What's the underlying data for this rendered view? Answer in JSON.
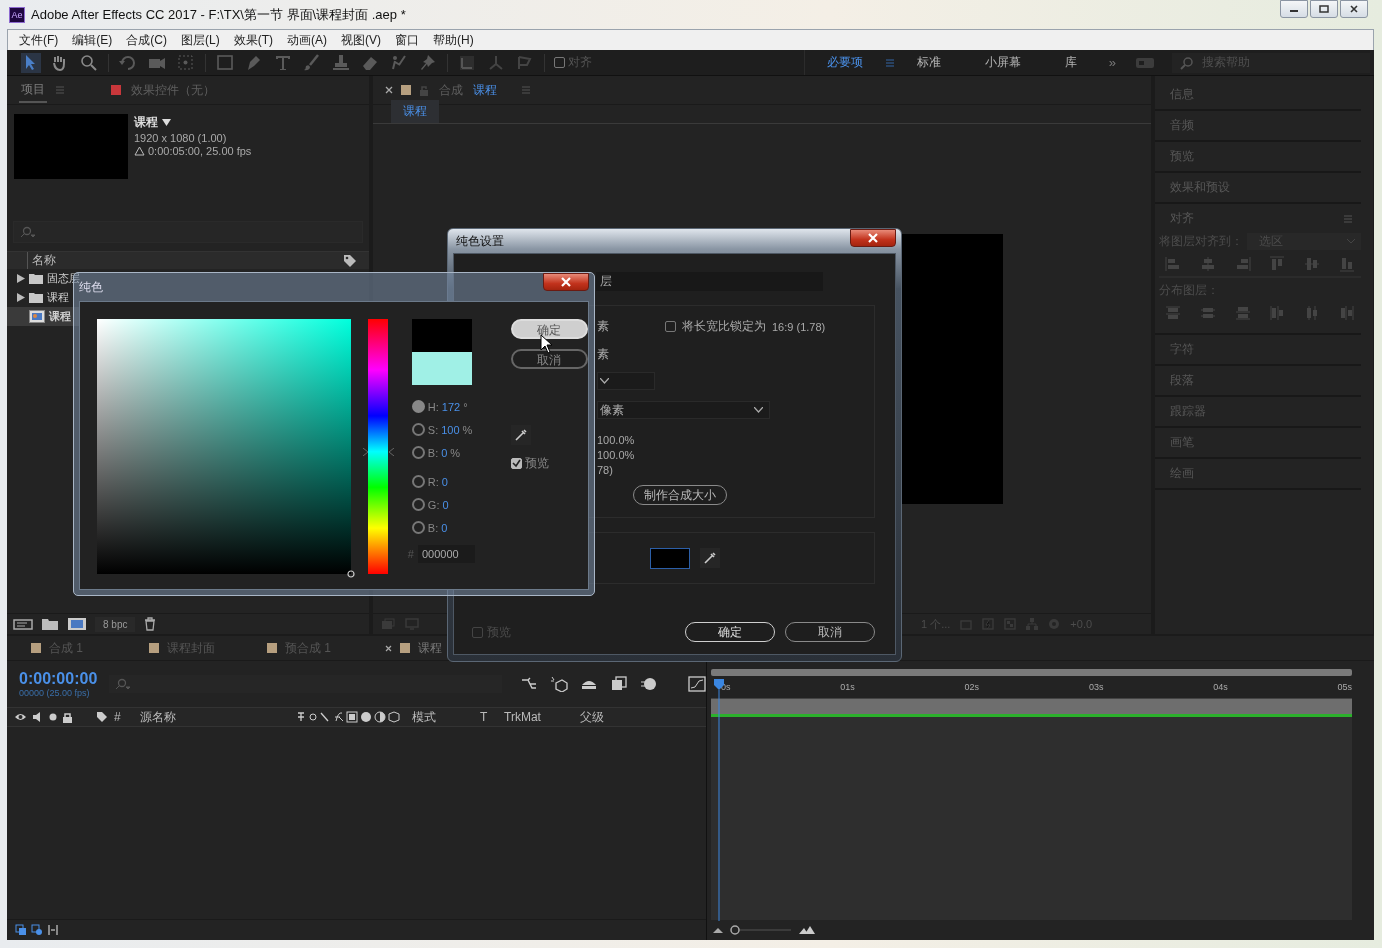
{
  "window": {
    "app_badge": "Ae",
    "title": "Adobe After Effects CC 2017 - F:\\TX\\第一节 界面\\课程封面 .aep *"
  },
  "menu": [
    {
      "label": "文件(F)"
    },
    {
      "label": "编辑(E)"
    },
    {
      "label": "合成(C)"
    },
    {
      "label": "图层(L)"
    },
    {
      "label": "效果(T)"
    },
    {
      "label": "动画(A)"
    },
    {
      "label": "视图(V)"
    },
    {
      "label": "窗口"
    },
    {
      "label": "帮助(H)"
    }
  ],
  "toolbar": {
    "snap": {
      "label": "对齐",
      "checked": false
    },
    "workspaces": [
      {
        "label": "必要项",
        "selected": true
      },
      {
        "label": "标准",
        "selected": false
      },
      {
        "label": "小屏幕",
        "selected": false
      },
      {
        "label": "库",
        "selected": false
      }
    ],
    "more": "»",
    "search": {
      "placeholder": "搜索帮助"
    }
  },
  "project_panel": {
    "tabs": [
      {
        "label": "项目",
        "selected": true
      },
      {
        "label": "效果控件（无）",
        "selected": false
      }
    ],
    "item": {
      "name": "课程",
      "size": "1920 x 1080 (1.00)",
      "duration": "0:00:05:00, 25.00 fps"
    },
    "name_column": "名称",
    "rows": [
      {
        "kind": "folder",
        "name": "固态层",
        "selected": false
      },
      {
        "kind": "folder",
        "name": "课程",
        "selected": false
      },
      {
        "kind": "composition",
        "name": "课程",
        "selected": true
      }
    ],
    "bit_depth": "8 bpc"
  },
  "comp_panel": {
    "tab": {
      "prefix": "合成",
      "name": "课程"
    },
    "view_tabs": [
      {
        "label": "课程",
        "selected": true
      }
    ],
    "footer": {
      "layers": "1 个...",
      "exposure": "+0.0"
    }
  },
  "right_panel": {
    "panels": [
      {
        "label": "信息",
        "expanded": false
      },
      {
        "label": "音频",
        "expanded": false
      },
      {
        "label": "预览",
        "expanded": false
      },
      {
        "label": "效果和预设",
        "expanded": false
      },
      {
        "label": "对齐",
        "expanded": true
      },
      {
        "label": "字符",
        "expanded": false
      },
      {
        "label": "段落",
        "expanded": false
      },
      {
        "label": "跟踪器",
        "expanded": false
      },
      {
        "label": "画笔",
        "expanded": false
      },
      {
        "label": "绘画",
        "expanded": false
      }
    ],
    "align": {
      "align_to_label": "将图层对齐到：",
      "align_to": "选区",
      "distribute_label": "分布图层："
    }
  },
  "timeline": {
    "tabs": [
      {
        "label": "合成 1",
        "selected": false
      },
      {
        "label": "课程封面",
        "selected": false
      },
      {
        "label": "预合成 1",
        "selected": false
      },
      {
        "label": "课程",
        "selected": true
      }
    ],
    "timecode": "0:00:00:00",
    "frame_rate": "00000 (25.00 fps)",
    "columns": [
      {
        "label": "#"
      },
      {
        "label": "源名称"
      },
      {
        "label": "模式"
      },
      {
        "label": "T"
      },
      {
        "label": "TrkMat"
      },
      {
        "label": "父级"
      }
    ],
    "ruler": [
      "0s",
      "01s",
      "02s",
      "03s",
      "04s",
      "05s"
    ]
  },
  "solid_settings": {
    "title": "纯色设置",
    "name_value": "层",
    "width_unit": "素",
    "height_unit": "素",
    "lock_ratio": {
      "label": "将长宽比锁定为",
      "value": "16:9 (1.78)",
      "checked": false
    },
    "unit": "像素",
    "width_scale": "100.0%",
    "height_scale": "100.0%",
    "ratio_tail": "78)",
    "make_comp_size": "制作合成大小",
    "preview": {
      "label": "预览",
      "checked": false
    },
    "buttons": [
      {
        "label": "确定",
        "default": true
      },
      {
        "label": "取消",
        "default": false
      }
    ]
  },
  "color_picker": {
    "title": "纯色",
    "hue": {
      "level": 0.52
    },
    "swatches": [
      {
        "color": "#000000"
      },
      {
        "color": "#a0f0e6"
      }
    ],
    "field_groups": [
      [
        {
          "label": "H:",
          "value": "172",
          "unit": "°",
          "selected": true
        },
        {
          "label": "S:",
          "value": "100",
          "unit": "%",
          "selected": false
        },
        {
          "label": "B:",
          "value": "0",
          "unit": "%",
          "selected": false
        }
      ],
      [
        {
          "label": "R:",
          "value": "0",
          "selected": false
        },
        {
          "label": "G:",
          "value": "0",
          "selected": false
        },
        {
          "label": "B:",
          "value": "0",
          "selected": false
        }
      ]
    ],
    "hex_label": "#",
    "hex": "000000",
    "buttons": [
      {
        "label": "确定",
        "hovered": true
      },
      {
        "label": "取消",
        "hovered": false
      }
    ],
    "preview": {
      "label": "预览",
      "checked": true
    }
  }
}
